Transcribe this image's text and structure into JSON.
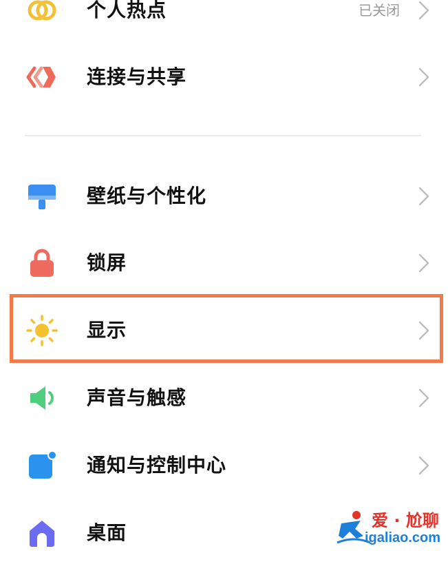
{
  "settings_list": {
    "items": [
      {
        "label": "个人热点",
        "status": "已关闭",
        "icon": "hotspot-icon"
      },
      {
        "label": "连接与共享",
        "icon": "connection-share-icon"
      },
      {
        "label": "壁纸与个性化",
        "icon": "wallpaper-icon"
      },
      {
        "label": "锁屏",
        "icon": "lock-icon"
      },
      {
        "label": "显示",
        "icon": "sun-icon"
      },
      {
        "label": "声音与触感",
        "icon": "speaker-icon"
      },
      {
        "label": "通知与控制中心",
        "icon": "notification-icon"
      },
      {
        "label": "桌面",
        "icon": "home-icon"
      }
    ],
    "highlighted_item": "显示"
  },
  "watermark": {
    "title": "爱 · 尬聊",
    "url": "igaliao.com"
  },
  "colors": {
    "highlight_border": "#f2794a",
    "hotspot": "#f0c23a",
    "connection": "#ee6a5a",
    "wallpaper": "#3a8ff0",
    "lock": "#ef6b5f",
    "sun": "#f5c12e",
    "speaker": "#4fce7f",
    "notification": "#2b93ee",
    "home": "#6b6cf2"
  }
}
